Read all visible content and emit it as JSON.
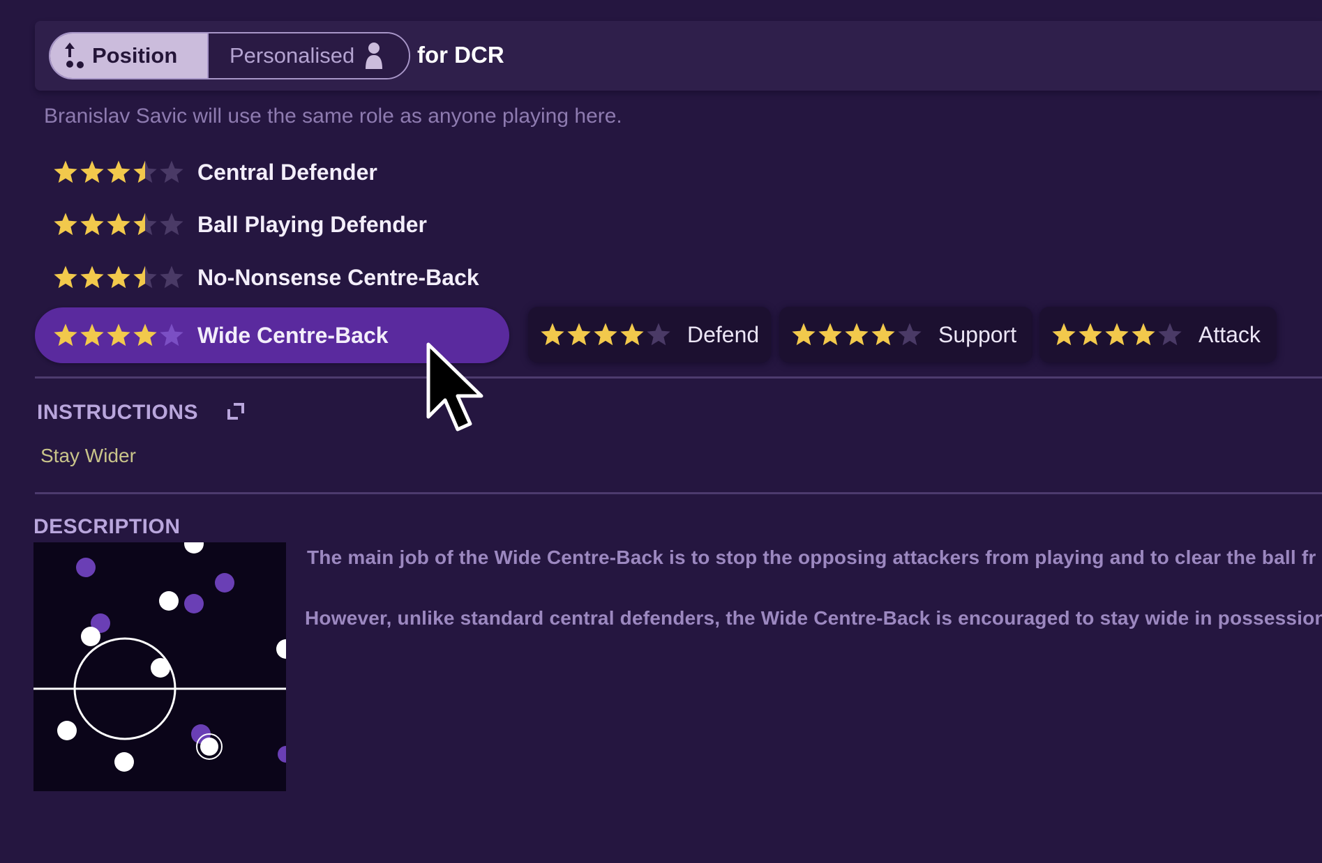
{
  "header": {
    "toggle": {
      "position_label": "Position",
      "personalised_label": "Personalised",
      "selected": "Position"
    },
    "for_label": "for DCR"
  },
  "intro_text": "Branislav Savic will use the same role as anyone playing here.",
  "roles": [
    {
      "name": "Central Defender",
      "rating": 3.5,
      "max": 5,
      "selected": false
    },
    {
      "name": "Ball Playing Defender",
      "rating": 3.5,
      "max": 5,
      "selected": false
    },
    {
      "name": "No-Nonsense Centre-Back",
      "rating": 3.5,
      "max": 5,
      "selected": false
    },
    {
      "name": "Wide Centre-Back",
      "rating": 4,
      "max": 5,
      "selected": true
    }
  ],
  "duties": [
    {
      "name": "Defend",
      "rating": 4,
      "max": 5
    },
    {
      "name": "Support",
      "rating": 4,
      "max": 5
    },
    {
      "name": "Attack",
      "rating": 4,
      "max": 5
    }
  ],
  "instructions": {
    "title": "INSTRUCTIONS",
    "icon": "popout-icon",
    "items": [
      "Stay Wider"
    ]
  },
  "description": {
    "title": "DESCRIPTION",
    "lines": [
      "The main job of the Wide Centre-Back is to stop the opposing attackers from playing and to clear the ball fr",
      "However, unlike standard central defenders, the Wide Centre-Back is encouraged to stay wide in possession"
    ]
  },
  "colors": {
    "star_filled": "#f2c94c",
    "star_empty": "#4a3a66",
    "star_empty_selected": "#7b4fc4",
    "selected_row": "#5a2a9e",
    "accent_instruction": "#c9c48a",
    "team_white": "#ffffff",
    "team_purple": "#6a3fb5"
  }
}
